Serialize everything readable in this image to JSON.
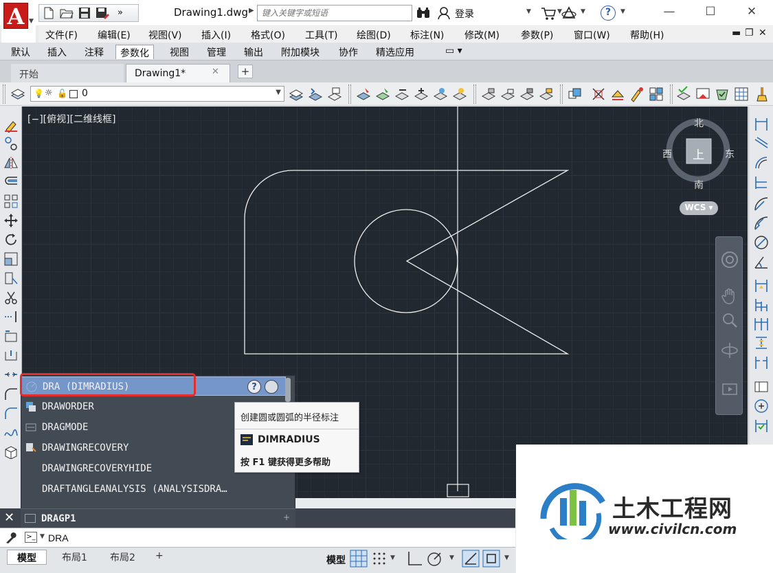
{
  "titlebar": {
    "doc_title": "Drawing1.dwg",
    "search_placeholder": "键入关键字或短语",
    "login_label": "登录"
  },
  "menubar": {
    "items": [
      "文件(F)",
      "编辑(E)",
      "视图(V)",
      "插入(I)",
      "格式(O)",
      "工具(T)",
      "绘图(D)",
      "标注(N)",
      "修改(M)",
      "参数(P)",
      "窗口(W)",
      "帮助(H)"
    ]
  },
  "ribbon": {
    "tabs": [
      "默认",
      "插入",
      "注释",
      "参数化",
      "视图",
      "管理",
      "输出",
      "附加模块",
      "协作",
      "精选应用"
    ],
    "active_tab": "参数化"
  },
  "file_tabs": {
    "start": "开始",
    "drawing": "Drawing1*"
  },
  "layer_toolbar": {
    "current_layer": "0"
  },
  "canvas": {
    "view_label": "[−][俯视][二维线框]",
    "background": "#212830"
  },
  "viewcube": {
    "north": "北",
    "south": "南",
    "east": "东",
    "west": "西",
    "top": "上",
    "wcs": "WCS"
  },
  "autocomplete": {
    "items": [
      "DRA (DIMRADIUS)",
      "DRAWORDER",
      "DRAGMODE",
      "DRAWINGRECOVERY",
      "DRAWINGRECOVERYHIDE",
      "DRAFTANGLEANALYSIS (ANALYSISDRA…"
    ],
    "bottom_item": "DRAGP1"
  },
  "tooltip": {
    "description": "创建圆或圆弧的半径标注",
    "command": "DIMRADIUS",
    "help_hint": "按 F1 键获得更多帮助"
  },
  "command_line": {
    "input_value": "DRA"
  },
  "status_bar": {
    "layout_tabs": [
      "模型",
      "布局1",
      "布局2"
    ],
    "model_label": "模型"
  },
  "watermark": {
    "title": "土木工程网",
    "url": "www.civilcn.com"
  },
  "colors": {
    "accent_red": "#c91a1a",
    "selection_blue": "#7596c9",
    "highlight_red": "#e32d2d"
  }
}
